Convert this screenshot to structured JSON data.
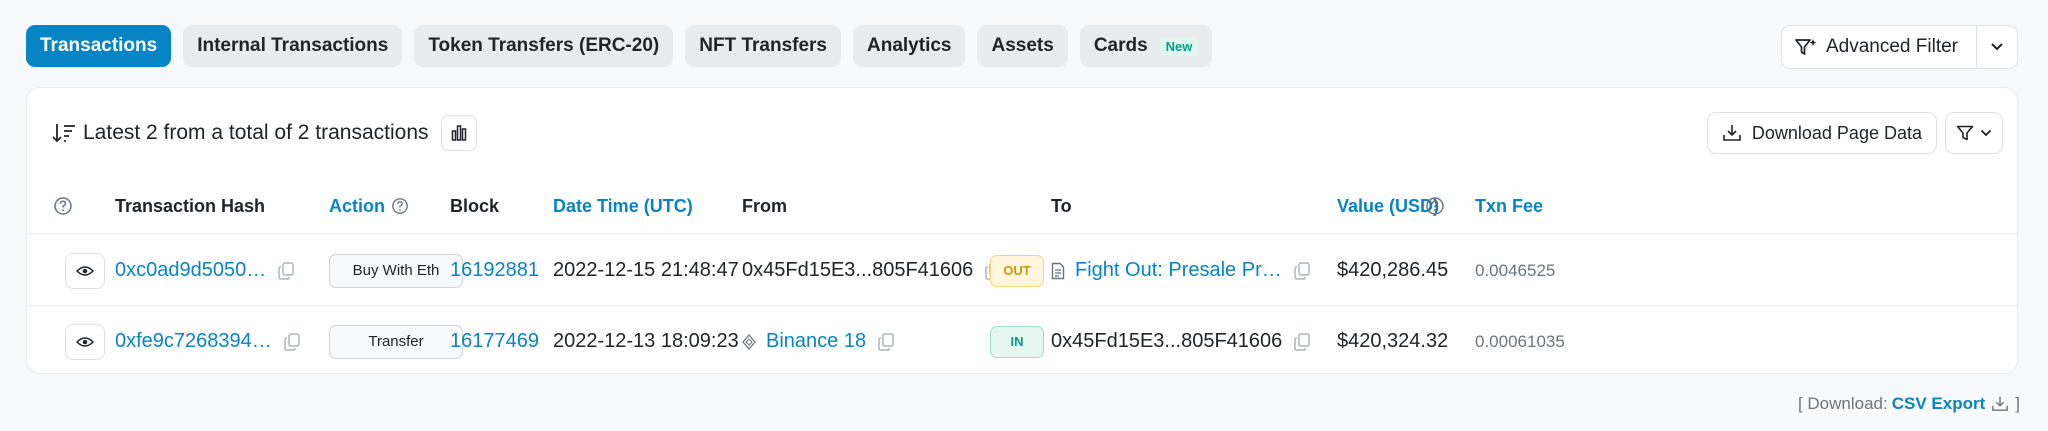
{
  "tabs": [
    {
      "label": "Transactions",
      "active": true
    },
    {
      "label": "Internal Transactions"
    },
    {
      "label": "Token Transfers (ERC-20)"
    },
    {
      "label": "NFT Transfers"
    },
    {
      "label": "Analytics"
    },
    {
      "label": "Assets"
    },
    {
      "label": "Cards",
      "badge": "New"
    }
  ],
  "advanced_filter": {
    "label": "Advanced Filter"
  },
  "summary": {
    "text": "Latest 2 from a total of 2 transactions"
  },
  "download_page": {
    "label": "Download Page Data"
  },
  "table": {
    "headers": {
      "hash": "Transaction Hash",
      "action": "Action",
      "block": "Block",
      "datetime": "Date Time (UTC)",
      "from": "From",
      "to": "To",
      "value": "Value (USD)",
      "fee": "Txn Fee"
    },
    "rows": [
      {
        "hash": "0xc0ad9d5050…",
        "action": "Buy With Eth",
        "block": "16192881",
        "datetime": "2022-12-15 21:48:47",
        "from": "0x45Fd15E3...805F41606",
        "direction": "OUT",
        "to": "Fight Out: Presale Pr…",
        "value": "$420,286.45",
        "fee": "0.0046525"
      },
      {
        "hash": "0xfe9c7268394…",
        "action": "Transfer",
        "block": "16177469",
        "datetime": "2022-12-13 18:09:23",
        "from": "Binance 18",
        "direction": "IN",
        "to": "0x45Fd15E3...805F41606",
        "value": "$420,324.32",
        "fee": "0.00061035"
      }
    ]
  },
  "footer": {
    "prefix": "[ Download:",
    "link": "CSV Export",
    "suffix": "]"
  },
  "colors": {
    "accent": "#0784c3",
    "out": "#cc9a06",
    "in": "#00a186"
  }
}
